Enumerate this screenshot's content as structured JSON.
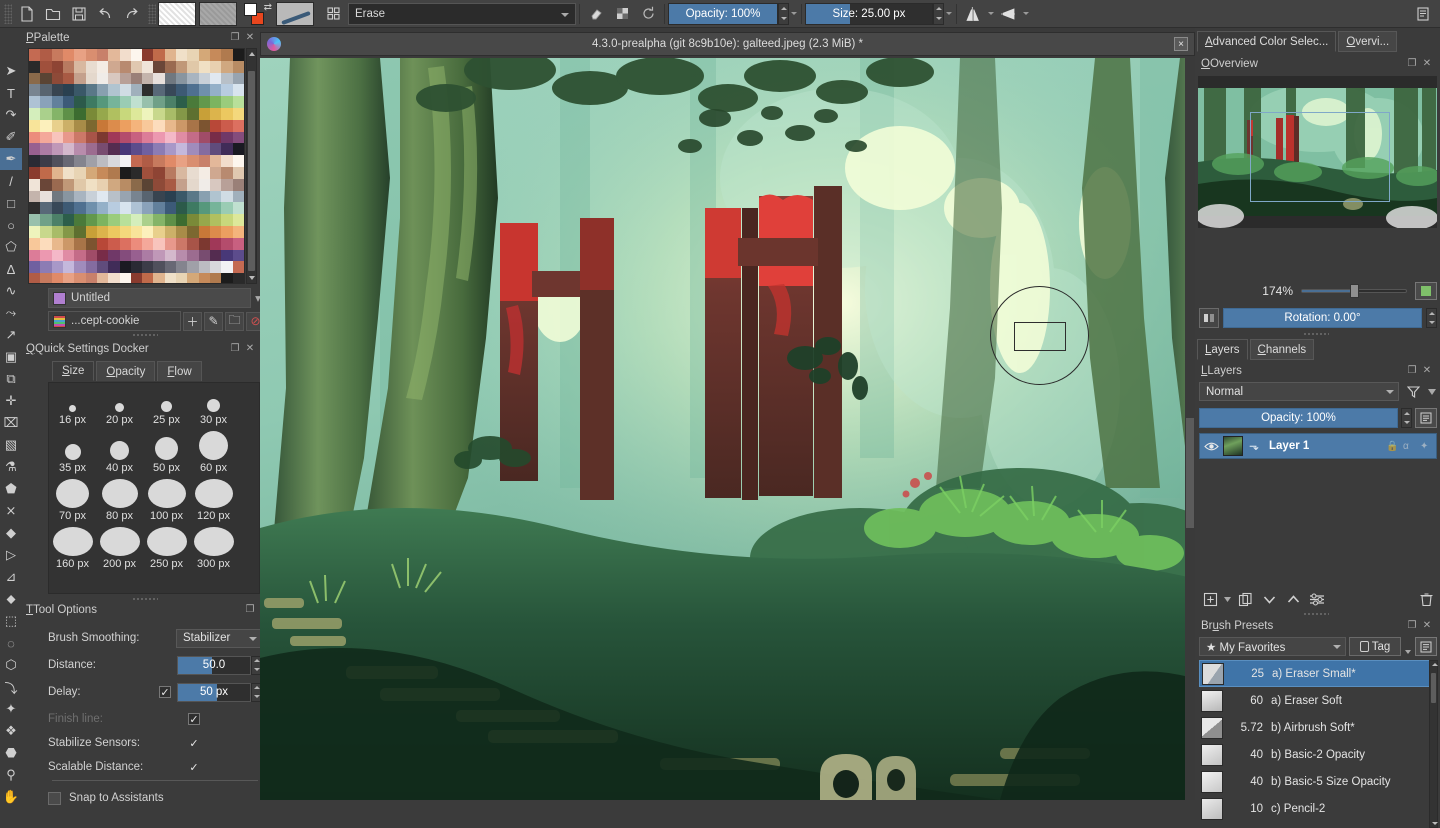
{
  "toolbar": {
    "icons": [
      "new-file-icon",
      "open-file-icon",
      "save-icon",
      "undo-icon",
      "redo-icon"
    ],
    "preset_name": "Erase",
    "opacity_label": "Opacity: 100%",
    "size_label": "Size: 25.00 px",
    "eraser_toggle": "eraser-icon",
    "alpha_toggle": "alpha-lock-icon",
    "reload_icon": "reset-icon",
    "mirror_h_icon": "mirror-horizontal-icon",
    "mirror_v_icon": "mirror-vertical-icon",
    "overflow_icon": "toolbar-overflow-icon"
  },
  "toolbox": {
    "tools": [
      {
        "name": "select-shapes-tool",
        "glyph": "➤",
        "active": false
      },
      {
        "name": "text-tool",
        "glyph": "T",
        "active": false
      },
      {
        "name": "edit-shapes-tool",
        "glyph": "↷",
        "active": false
      },
      {
        "name": "calligraphy-tool",
        "glyph": "✐",
        "active": false
      },
      {
        "name": "freehand-brush-tool",
        "glyph": "✒",
        "active": true
      },
      {
        "name": "line-tool",
        "glyph": "/",
        "active": false
      },
      {
        "name": "rectangle-tool",
        "glyph": "□",
        "active": false
      },
      {
        "name": "ellipse-tool",
        "glyph": "○",
        "active": false
      },
      {
        "name": "polygon-tool",
        "glyph": "⬠",
        "active": false
      },
      {
        "name": "polyline-tool",
        "glyph": "∆",
        "active": false
      },
      {
        "name": "bezier-curve-tool",
        "glyph": "∿",
        "active": false
      },
      {
        "name": "freehand-path-tool",
        "glyph": "⤳",
        "active": false
      },
      {
        "name": "dynamic-brush-tool",
        "glyph": "↗",
        "active": false
      },
      {
        "name": "multibrush-tool",
        "glyph": "▣",
        "active": false
      },
      {
        "name": "transform-tool",
        "glyph": "⧉",
        "active": false
      },
      {
        "name": "move-tool",
        "glyph": "✛",
        "active": false
      },
      {
        "name": "crop-tool",
        "glyph": "⌧",
        "active": false
      },
      {
        "name": "gradient-tool",
        "glyph": "▧",
        "active": false
      },
      {
        "name": "color-picker-tool",
        "glyph": "⚗",
        "active": false
      },
      {
        "name": "fill-tool",
        "glyph": "⬟",
        "active": false
      },
      {
        "name": "smart-patch-tool",
        "glyph": "⨯",
        "active": false
      },
      {
        "name": "colorize-mask-tool",
        "glyph": "◆",
        "active": false
      },
      {
        "name": "assistant-tool",
        "glyph": "▷",
        "active": false
      },
      {
        "name": "measure-tool",
        "glyph": "⊿",
        "active": false
      },
      {
        "name": "reference-images-tool",
        "glyph": "⬥",
        "active": false
      },
      {
        "name": "rectangular-select-tool",
        "glyph": "⬚",
        "active": false
      },
      {
        "name": "elliptical-select-tool",
        "glyph": "◌",
        "active": false
      },
      {
        "name": "polygonal-select-tool",
        "glyph": "⬡",
        "active": false
      },
      {
        "name": "freehand-select-tool",
        "glyph": "⤵",
        "active": false
      },
      {
        "name": "contiguous-select-tool",
        "glyph": "✦",
        "active": false
      },
      {
        "name": "similar-color-select-tool",
        "glyph": "❖",
        "active": false
      },
      {
        "name": "magnetic-select-tool",
        "glyph": "⬣",
        "active": false
      },
      {
        "name": "zoom-tool",
        "glyph": "⚲",
        "active": false
      },
      {
        "name": "pan-tool",
        "glyph": "✋",
        "active": false
      }
    ]
  },
  "palette_docker": {
    "title": "Palette",
    "float_icon": "float-docker-icon",
    "close_icon": "close-docker-icon",
    "selected_palette": "Untitled",
    "resource_name": "...cept-cookie",
    "buttons": [
      "add-swatch-button",
      "edit-swatch-button",
      "add-group-button",
      "remove-swatch-button"
    ]
  },
  "quick_settings": {
    "title": "Quick Settings Docker",
    "tabs": [
      {
        "label": "Size",
        "active": true
      },
      {
        "label": "Opacity",
        "active": false
      },
      {
        "label": "Flow",
        "active": false
      }
    ],
    "sizes": [
      [
        {
          "label": "16 px",
          "d": 7
        },
        {
          "label": "20 px",
          "d": 9
        },
        {
          "label": "25 px",
          "d": 11
        },
        {
          "label": "30 px",
          "d": 13
        }
      ],
      [
        {
          "label": "35 px",
          "d": 16
        },
        {
          "label": "40 px",
          "d": 19
        },
        {
          "label": "50 px",
          "d": 23
        },
        {
          "label": "60 px",
          "d": 29
        }
      ],
      [
        {
          "label": "70 px",
          "d": 33
        },
        {
          "label": "80 px",
          "d": 36
        },
        {
          "label": "100 px",
          "d": 38
        },
        {
          "label": "120 px",
          "d": 38
        }
      ],
      [
        {
          "label": "160 px",
          "d": 40
        },
        {
          "label": "200 px",
          "d": 40
        },
        {
          "label": "250 px",
          "d": 40
        },
        {
          "label": "300 px",
          "d": 40
        }
      ]
    ]
  },
  "tool_options": {
    "title": "Tool Options",
    "brush_smoothing_label": "Brush Smoothing:",
    "brush_smoothing_value": "Stabilizer",
    "distance_label": "Distance:",
    "distance_value": "50.0",
    "delay_label": "Delay:",
    "delay_checked": "✓",
    "delay_value": "50",
    "delay_unit": "px",
    "finish_line_label": "Finish line:",
    "finish_line_checked": "✓",
    "stabilize_sensors_label": "Stabilize Sensors:",
    "stabilize_sensors_checked": "✓",
    "scalable_distance_label": "Scalable Distance:",
    "scalable_distance_checked": "✓",
    "snap_to_assistants_label": "Snap to Assistants",
    "snap_to_assistants_checked": ""
  },
  "canvas": {
    "window_title": "4.3.0-prealpha (git 8c9b10e): galteed.jpeg (2.3 MiB) *",
    "close_label": "×",
    "app_icon": "krita-logo-icon"
  },
  "right_tabs": [
    {
      "label": "Advanced Color Selec...",
      "active": true
    },
    {
      "label": "Overvi...",
      "active": false
    }
  ],
  "overview": {
    "title": "Overview",
    "zoom_value": "174%",
    "rotation_label": "Rotation: 0.00°",
    "fit_icon": "fit-page-icon",
    "mirror_icon": "mirror-canvas-icon"
  },
  "layers": {
    "tabs": [
      {
        "label": "Layers",
        "active": true
      },
      {
        "label": "Channels",
        "active": false
      }
    ],
    "title": "Layers",
    "blend_mode": "Normal",
    "filter_icon": "filter-icon",
    "opacity_label": "Opacity:  100%",
    "properties_icon": "layer-properties-icon",
    "rows": [
      {
        "name": "Layer 1",
        "visible_icon": "eye-icon",
        "alpha_icon": "alpha-inherit-icon"
      }
    ],
    "bottom_buttons": [
      "add-layer-button",
      "duplicate-layer-button",
      "move-layer-down-button",
      "move-layer-up-button",
      "layer-properties-button",
      "delete-layer-button"
    ]
  },
  "brush_presets": {
    "title": "Brush Presets",
    "tag_selector": "★ My Favorites",
    "tag_button": "Tag",
    "settings_icon": "preset-settings-icon",
    "presets": [
      {
        "size": "25",
        "name": "a) Eraser Small*",
        "selected": true,
        "thumb": "eraser-small-thumb"
      },
      {
        "size": "60",
        "name": "a) Eraser Soft",
        "selected": false,
        "thumb": "eraser-soft-thumb"
      },
      {
        "size": "5.72",
        "name": "b) Airbrush Soft*",
        "selected": false,
        "thumb": "airbrush-soft-thumb"
      },
      {
        "size": "40",
        "name": "b) Basic-2 Opacity",
        "selected": false,
        "thumb": "basic2-thumb"
      },
      {
        "size": "40",
        "name": "b) Basic-5 Size Opacity",
        "selected": false,
        "thumb": "basic5-thumb"
      },
      {
        "size": "10",
        "name": "c) Pencil-2",
        "selected": false,
        "thumb": "pencil2-thumb"
      }
    ]
  },
  "colors": {
    "accent": "#4c7aa8",
    "selection": "#3f74a8",
    "panel": "#3b3b3b",
    "toolbar": "#434343",
    "field": "#2f2f2f",
    "text": "#d4d4d4",
    "fg_swatch": "#ffffff",
    "bg_swatch": "#e8461e"
  },
  "palette_swatches": [
    "#c46a52",
    "#b05c46",
    "#c77a5e",
    "#e08a68",
    "#e8a184",
    "#d98e70",
    "#c8806a",
    "#e3b89a",
    "#f2ddcc",
    "#fdf6ee",
    "#8a3b2e",
    "#c06a4a",
    "#e0b48e",
    "#f0e0c8",
    "#e8d4b4",
    "#d4a878",
    "#c68a5a",
    "#b07a4e",
    "#1c1c1c",
    "#2a2a2a",
    "#a0503c",
    "#8e4434",
    "#b87a60",
    "#d8b8a0",
    "#e8dcd0",
    "#f4ece4",
    "#cfa890",
    "#b88a70",
    "#e0c8b0",
    "#f0e4d8",
    "#6a4638",
    "#9a6a50",
    "#c09878",
    "#e0c8a8",
    "#f0e0c4",
    "#e8d0b0",
    "#d0a880",
    "#b88c64",
    "#8a6a4a",
    "#5a4434",
    "#8e4a38",
    "#a85a44",
    "#c4a08c",
    "#e4d8cc",
    "#f0ece8",
    "#d8c8c0",
    "#b8a098",
    "#9a8078",
    "#c4b4ac",
    "#e8e0dc",
    "#707880",
    "#8895a0",
    "#a8b4c0",
    "#c8d0d8",
    "#e0e8f0",
    "#b8c0c8",
    "#98a4b0",
    "#788490",
    "#586470",
    "#384450",
    "#2a4050",
    "#3a5868",
    "#5a7888",
    "#88a0b0",
    "#b0c4d0",
    "#d0dce4",
    "#a0b0bc",
    "#7888981",
    "#586878",
    "#384858",
    "#3d5a74",
    "#4f7090",
    "#6f90ac",
    "#94b0c8",
    "#b8cce0",
    "#d8e4ee",
    "#aec2d4",
    "#8aa2ba",
    "#62809c",
    "#3c5a78",
    "#2c5a4a",
    "#3e7a62",
    "#56987c",
    "#76b49a",
    "#9accb4",
    "#c0e0d0",
    "#98c0ac",
    "#70a088",
    "#4c8068",
    "#2c5e4a",
    "#4a7a3a",
    "#62984c",
    "#7cb460",
    "#9acc7c",
    "#b8e09a",
    "#d4eebc",
    "#aad08c",
    "#84b468",
    "#5e9048",
    "#3c6c30",
    "#7a8a38",
    "#96a84c",
    "#b0c060",
    "#c8d87c",
    "#dde89a",
    "#eef4bc",
    "#c8d88c",
    "#a8bc68",
    "#849848",
    "#5e7030",
    "#c8a038",
    "#dcb44c",
    "#ecc860",
    "#f4d87c",
    "#f8e49a",
    "#fcf0bc",
    "#e8d08c",
    "#ccb068",
    "#a88c48",
    "#7c6830",
    "#c87838",
    "#dc8c4c",
    "#ec9f60",
    "#f4b47c",
    "#f8c89a",
    "#fcdcbc",
    "#e8b88c",
    "#cc9868",
    "#a87448",
    "#7c5430",
    "#b84838",
    "#cc5c4c",
    "#dc7060",
    "#ec8c7c",
    "#f4a89a",
    "#f8c4bc",
    "#e8988c",
    "#cc7868",
    "#a85448",
    "#7c3830",
    "#a03858",
    "#b44c6c",
    "#c86080",
    "#dc7c98",
    "#ec98b0",
    "#f4b8c8",
    "#e08ca4",
    "#c46c88",
    "#a04c68",
    "#782c48",
    "#703868",
    "#844c7c",
    "#986090",
    "#ac7ca4",
    "#c098b8",
    "#d4b8cc",
    "#b88cac",
    "#9c6c90",
    "#784c70",
    "#542c50",
    "#483878",
    "#5c4c8c",
    "#7060a0",
    "#8c7cb4",
    "#a898c8",
    "#c4b8dc",
    "#a08cbc",
    "#846ca0",
    "#604c7c",
    "#402c58",
    "#1a1a22",
    "#2a2a34",
    "#3c3c48",
    "#50505c",
    "#686874",
    "#84848e",
    "#a0a0a8",
    "#bcbcc2",
    "#d8d8dc",
    "#f2f2f4"
  ]
}
